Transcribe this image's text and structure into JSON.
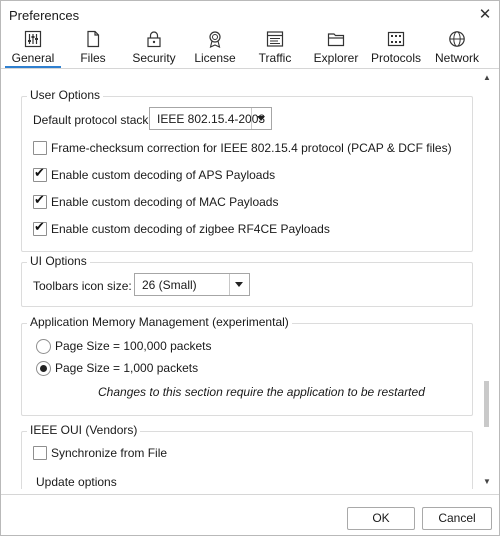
{
  "window": {
    "title": "Preferences",
    "close_glyph": "✕"
  },
  "tabs": [
    {
      "label": "General",
      "icon": "sliders-icon",
      "selected": true
    },
    {
      "label": "Files",
      "icon": "file-icon",
      "selected": false
    },
    {
      "label": "Security",
      "icon": "lock-icon",
      "selected": false
    },
    {
      "label": "License",
      "icon": "award-ribbon-icon",
      "selected": false
    },
    {
      "label": "Traffic",
      "icon": "traffic-window-icon",
      "selected": false
    },
    {
      "label": "Explorer",
      "icon": "folder-icon",
      "selected": false
    },
    {
      "label": "Protocols",
      "icon": "circuit-board-icon",
      "selected": false
    },
    {
      "label": "Network",
      "icon": "globe-icon",
      "selected": false
    }
  ],
  "user_options": {
    "title": "User Options",
    "protocol_stack_label": "Default protocol stack:",
    "protocol_stack_value": "IEEE 802.15.4-2003",
    "checkboxes": [
      {
        "label": "Frame-checksum correction for IEEE 802.15.4 protocol (PCAP & DCF files)",
        "checked": false
      },
      {
        "label": "Enable custom decoding of APS Payloads",
        "checked": true
      },
      {
        "label": "Enable custom decoding of MAC Payloads",
        "checked": true
      },
      {
        "label": "Enable custom decoding of zigbee RF4CE Payloads",
        "checked": true
      }
    ]
  },
  "ui_options": {
    "title": "UI Options",
    "icon_size_label": "Toolbars icon size:",
    "icon_size_value": "26 (Small)"
  },
  "memory": {
    "title": "Application Memory Management (experimental)",
    "options": [
      {
        "label": "Page Size = 100,000 packets",
        "selected": false
      },
      {
        "label": "Page Size = 1,000 packets",
        "selected": true
      }
    ],
    "note": "Changes to this section require the application to be restarted"
  },
  "oui": {
    "title": "IEEE OUI (Vendors)",
    "sync_label": "Synchronize from File",
    "sync_checked": false,
    "update_label": "Update options"
  },
  "buttons": {
    "ok": "OK",
    "cancel": "Cancel"
  },
  "colors": {
    "accent": "#2f80d0"
  }
}
